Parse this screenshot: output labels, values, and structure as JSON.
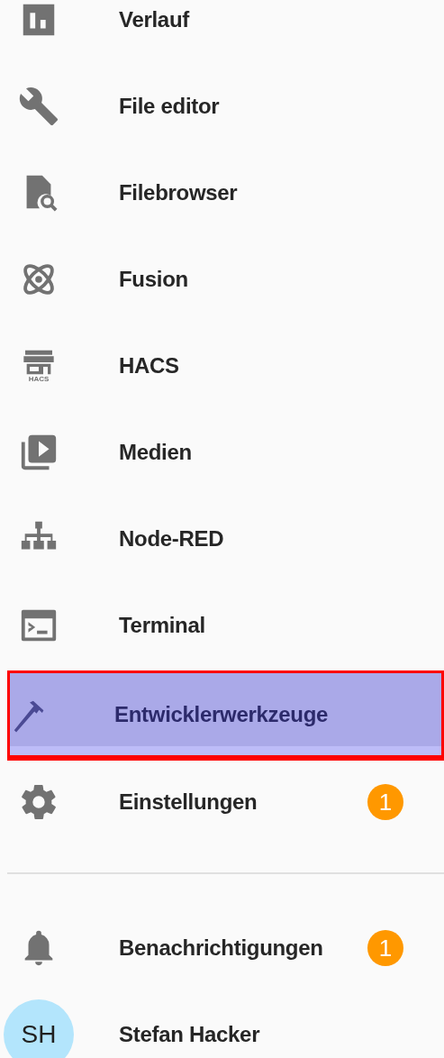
{
  "sidebar": {
    "items": [
      {
        "label": "Verlauf",
        "kind": "chart",
        "selected": false
      },
      {
        "label": "File editor",
        "kind": "wrench",
        "selected": false
      },
      {
        "label": "Filebrowser",
        "kind": "filesearch",
        "selected": false
      },
      {
        "label": "Fusion",
        "kind": "atom",
        "selected": false
      },
      {
        "label": "HACS",
        "kind": "store",
        "icon_text": "HACS",
        "selected": false
      },
      {
        "label": "Medien",
        "kind": "media",
        "selected": false
      },
      {
        "label": "Node-RED",
        "kind": "sitemap",
        "selected": false
      },
      {
        "label": "Terminal",
        "kind": "console",
        "selected": false
      },
      {
        "label": "Entwicklerwerkzeuge",
        "kind": "hammer",
        "selected": true
      },
      {
        "label": "Einstellungen",
        "kind": "gear",
        "selected": false,
        "badge": "1"
      }
    ],
    "footer": [
      {
        "label": "Benachrichtigungen",
        "kind": "bell",
        "badge": "1"
      }
    ],
    "user": {
      "initials": "SH",
      "name": "Stefan Hacker"
    }
  }
}
